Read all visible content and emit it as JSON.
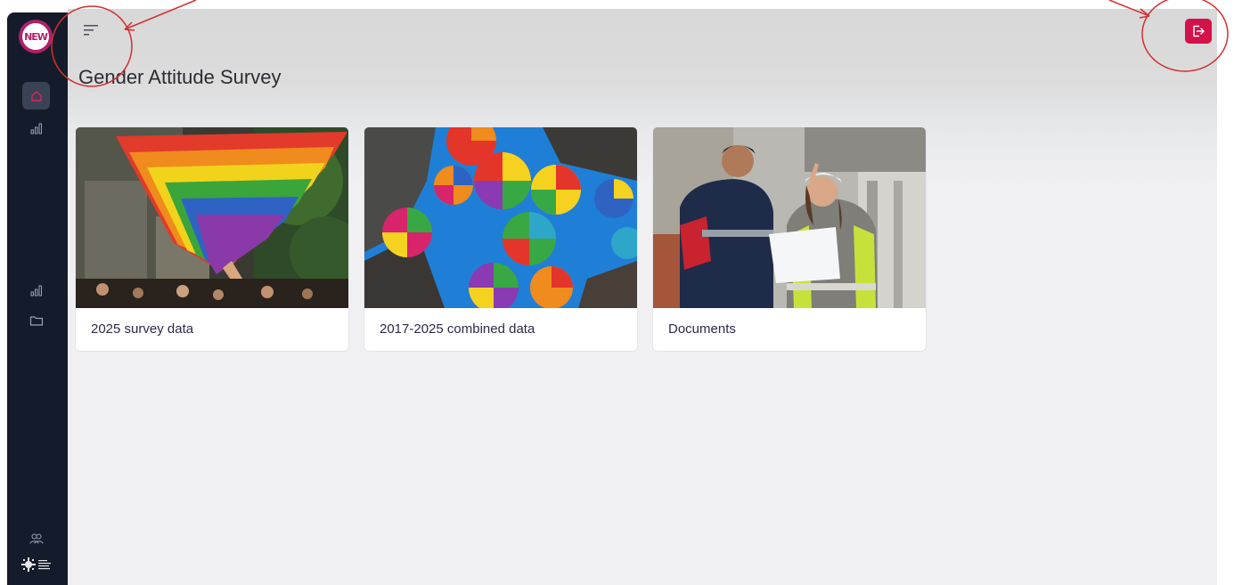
{
  "app": {
    "logo_text": "NEW"
  },
  "sidebar": {
    "items": [
      {
        "icon": "home-icon"
      },
      {
        "icon": "bar-chart-icon"
      },
      {
        "icon": "bar-chart-icon"
      },
      {
        "icon": "folder-icon"
      },
      {
        "icon": "users-icon"
      },
      {
        "icon": "partner-logo"
      }
    ]
  },
  "header": {
    "menu_icon": "menu-icon",
    "logout_icon": "logout-icon"
  },
  "page": {
    "title": "Gender Attitude Survey"
  },
  "cards": [
    {
      "label": "2025 survey data",
      "image": "rainbow-flag-photo"
    },
    {
      "label": "2017-2025 combined data",
      "image": "rainbow-umbrellas-photo"
    },
    {
      "label": "Documents",
      "image": "construction-workers-photo"
    }
  ],
  "colors": {
    "sidebar_bg": "#141b2a",
    "accent": "#d5114a",
    "annotation": "#d32f2f"
  }
}
